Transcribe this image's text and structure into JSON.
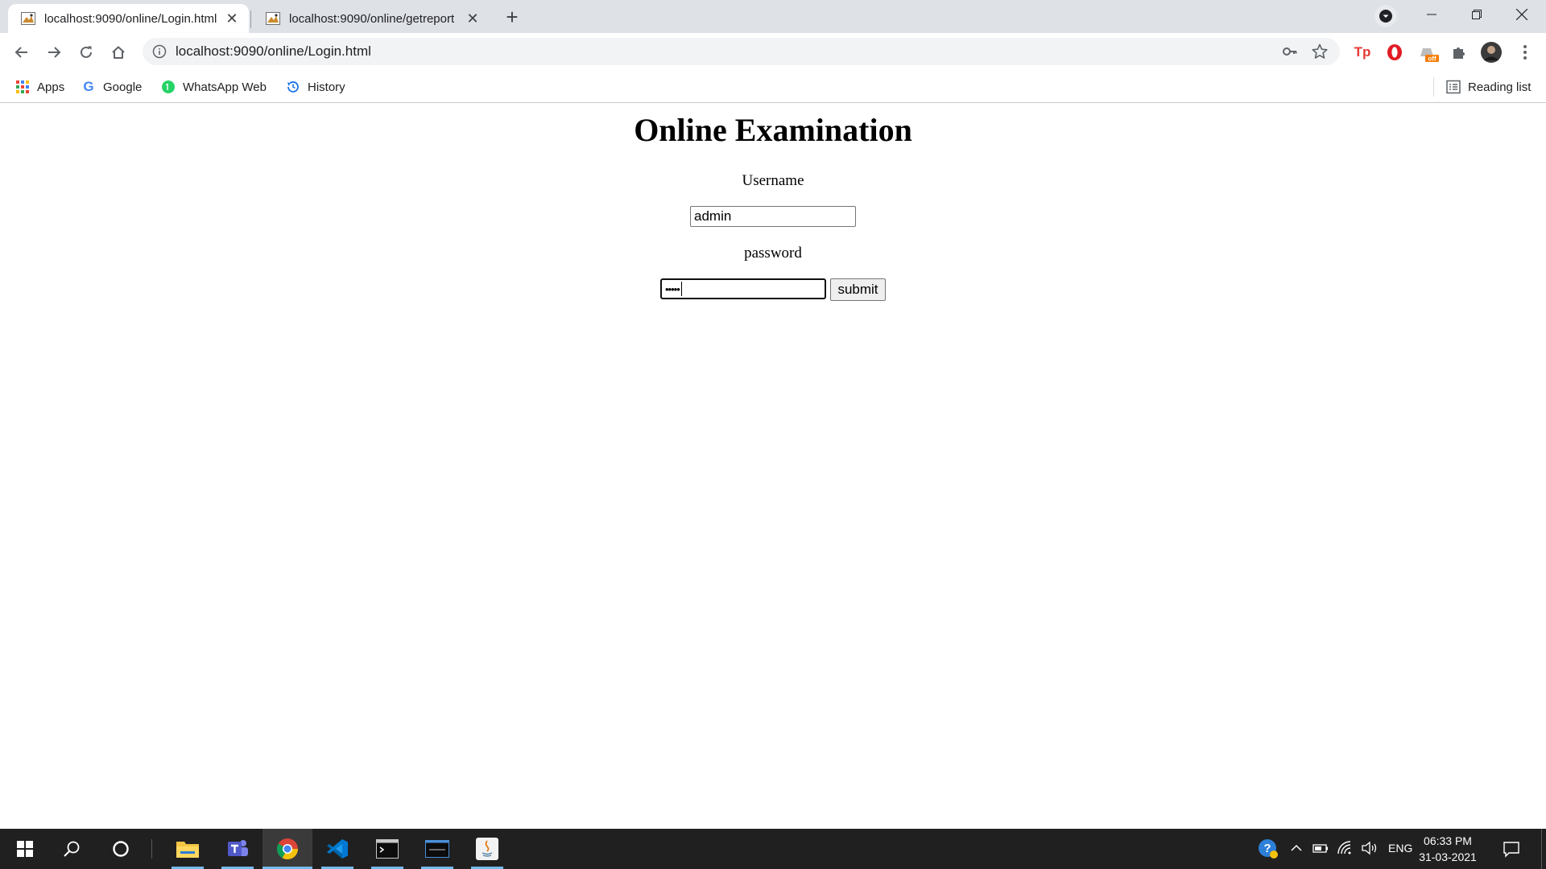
{
  "browser": {
    "tabs": [
      {
        "title": "localhost:9090/online/Login.html",
        "active": true
      },
      {
        "title": "localhost:9090/online/getreport",
        "active": false
      }
    ],
    "address": "localhost:9090/online/Login.html",
    "bookmarks": [
      {
        "label": "Apps",
        "icon": "apps-grid-icon"
      },
      {
        "label": "Google",
        "icon": "google-icon"
      },
      {
        "label": "WhatsApp Web",
        "icon": "whatsapp-icon"
      },
      {
        "label": "History",
        "icon": "history-icon"
      }
    ],
    "reading_list": "Reading list",
    "extensions": [
      "tp-extension-icon",
      "opera-extension-icon",
      "off-extension-icon",
      "puzzle-extensions-icon",
      "profile-avatar-icon",
      "kebab-menu-icon"
    ],
    "extension_badge": "off"
  },
  "page": {
    "heading": "Online Examination",
    "username_label": "Username",
    "username_value": "admin",
    "password_label": "password",
    "password_masked": "•••••",
    "submit_label": "submit"
  },
  "taskbar": {
    "apps": [
      "windows-start-icon",
      "search-icon",
      "cortana-icon",
      "file-explorer-icon",
      "teams-icon",
      "chrome-icon",
      "vscode-icon",
      "terminal-icon",
      "mysql-icon",
      "java-icon"
    ],
    "language": "ENG",
    "time": "06:33 PM",
    "date": "31-03-2021"
  },
  "colors": {
    "tabstrip": "#dee1e6",
    "taskbar": "#202020",
    "taskbar_accent": "#76b9ed"
  }
}
